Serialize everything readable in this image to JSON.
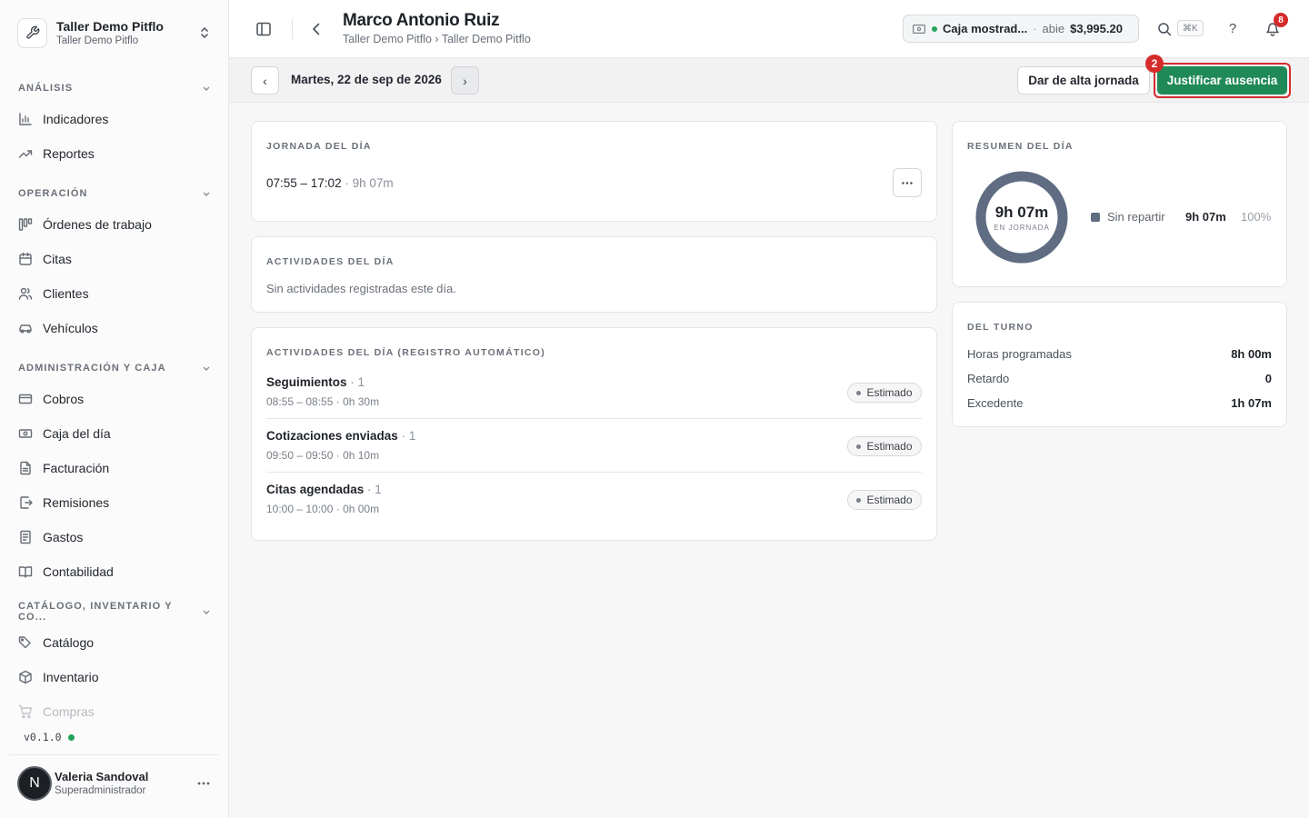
{
  "workspace": {
    "name": "Taller Demo Pitflo",
    "subtitle": "Taller Demo Pitflo"
  },
  "sidebar": {
    "sections": [
      {
        "label": "ANÁLISIS",
        "items": [
          {
            "label": "Indicadores",
            "icon": "bar-chart-icon"
          },
          {
            "label": "Reportes",
            "icon": "trending-up-icon"
          }
        ]
      },
      {
        "label": "OPERACIÓN",
        "items": [
          {
            "label": "Órdenes de trabajo",
            "icon": "kanban-icon"
          },
          {
            "label": "Citas",
            "icon": "calendar-icon"
          },
          {
            "label": "Clientes",
            "icon": "users-icon"
          },
          {
            "label": "Vehículos",
            "icon": "car-icon"
          }
        ]
      },
      {
        "label": "ADMINISTRACIÓN Y CAJA",
        "items": [
          {
            "label": "Cobros",
            "icon": "credit-card-icon"
          },
          {
            "label": "Caja del día",
            "icon": "banknote-icon"
          },
          {
            "label": "Facturación",
            "icon": "file-text-icon"
          },
          {
            "label": "Remisiones",
            "icon": "file-export-icon"
          },
          {
            "label": "Gastos",
            "icon": "receipt-icon"
          },
          {
            "label": "Contabilidad",
            "icon": "book-open-icon"
          }
        ]
      },
      {
        "label": "CATÁLOGO, INVENTARIO Y CO...",
        "items": [
          {
            "label": "Catálogo",
            "icon": "tags-icon"
          },
          {
            "label": "Inventario",
            "icon": "package-icon"
          },
          {
            "label": "Compras",
            "icon": "shopping-cart-icon"
          }
        ]
      }
    ],
    "version": "v0.1.0",
    "user": {
      "initial": "N",
      "name": "Valeria Sandoval",
      "role": "Superadministrador"
    }
  },
  "header": {
    "title": "Marco Antonio Ruiz",
    "breadcrumb": "Taller Demo Pitflo › Taller Demo Pitflo",
    "cash": {
      "name": "Caja mostrad...",
      "separator": "·",
      "status": "abie",
      "amount": "$3,995.20"
    },
    "search_shortcut": "⌘K",
    "help": "?",
    "notifications_count": "8"
  },
  "toolbar": {
    "prev": "‹",
    "next": "›",
    "date": "Martes, 22 de sep de 2026",
    "register_button": "Dar de alta jornada",
    "justify_button": "Justificar ausencia",
    "step_badge": "2"
  },
  "jornada": {
    "title": "JORNADA DEL DÍA",
    "range": "07:55 – 17:02",
    "duration": "9h 07m"
  },
  "activities": {
    "title": "ACTIVIDADES DEL DÍA",
    "empty": "Sin actividades registradas este día."
  },
  "auto_activities": {
    "title": "ACTIVIDADES DEL DÍA (REGISTRO AUTOMÁTICO)",
    "items": [
      {
        "name": "Seguimientos",
        "count": "1",
        "time": "08:55 – 08:55 · 0h 30m",
        "badge": "Estimado"
      },
      {
        "name": "Cotizaciones enviadas",
        "count": "1",
        "time": "09:50 – 09:50 · 0h 10m",
        "badge": "Estimado"
      },
      {
        "name": "Citas agendadas",
        "count": "1",
        "time": "10:00 – 10:00 · 0h 00m",
        "badge": "Estimado"
      }
    ]
  },
  "summary": {
    "title": "RESUMEN DEL DÍA",
    "total": "9h 07m",
    "total_label": "EN JORNADA",
    "legend": [
      {
        "name": "Sin repartir",
        "value": "9h 07m",
        "percent": "100%",
        "color": "#5f6c82"
      }
    ]
  },
  "shift": {
    "title": "DEL TURNO",
    "rows": [
      {
        "label": "Horas programadas",
        "value": "8h 00m"
      },
      {
        "label": "Retardo",
        "value": "0"
      },
      {
        "label": "Excedente",
        "value": "1h 07m"
      }
    ]
  },
  "colors": {
    "accent": "#1f8a57",
    "danger": "#d42b2b",
    "status_ok": "#22a35a",
    "donut": "#5f6c82"
  }
}
